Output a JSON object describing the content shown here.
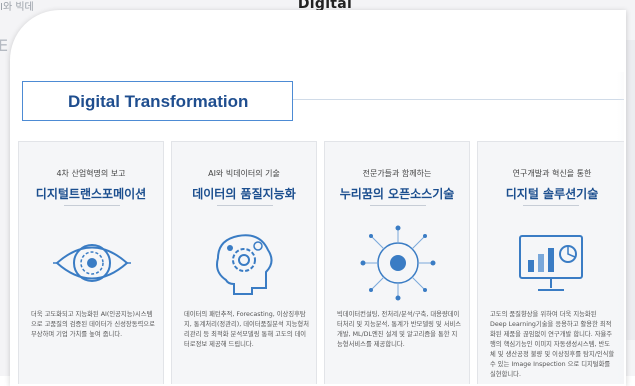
{
  "background": {
    "title": "Digital Transformation",
    "left_text": "I와 빅데",
    "left_bignum": "E"
  },
  "section": {
    "title": "Digital Transformation"
  },
  "columns": [
    {
      "subtitle": "4차 산업혁명의 보고",
      "title": "디지털트랜스포메이션",
      "icon": "eye-icon",
      "description": "더욱 고도화되고 지능화된 AI(인공지능)시스템으로 고품질의 검증된 데이터가 신성장동력으로 부상하며 기업 가치를 높여 줍니다."
    },
    {
      "subtitle": "AI와 빅데이터의 기술",
      "title": "데이터의 품질지능화",
      "icon": "brain-gear-icon",
      "description": "데이터의 패턴추적, Forecasting, 이상징후탐지, 통계처리(정관리), 데이터품질분석 지능형처리관리 등 최적화 분석모델링 통해 고도의 데이터로정보 제공해 드립니다."
    },
    {
      "subtitle": "전문가들과 함께하는",
      "title": "누리꿈의 오픈소스기술",
      "icon": "network-icon",
      "description": "빅데이터컨설팅, 전처리/분석/구축, 대용량데이터처리 및 지능분석, 통계가 반모델링 및 서비스개발, ML/DL엔진 설계 및 알고리즘을 통한 지능형서비스를 제공합니다."
    },
    {
      "subtitle": "연구개발과 혁신을 통한",
      "title": "디지털 솔루션기술",
      "icon": "monitor-chart-icon",
      "description": "고도의 품질향상을 위하여 더욱 지능화된 Deep Learning기술을 응용하고 활용한 최적화된 제품을 끊임없이 연구개발 합니다. 자율주행의 핵심기능인 이미지 자동생성시스템, 반도체 및 생산공정 불량 및 이상징후를 탐지/인식할 수 있는 Image Inspection 으로 디지털화를 실현합니다."
    }
  ],
  "colors": {
    "accent": "#1c4f8f",
    "header_border": "#4d8bd4",
    "icon_blue": "#3a7cc4"
  }
}
